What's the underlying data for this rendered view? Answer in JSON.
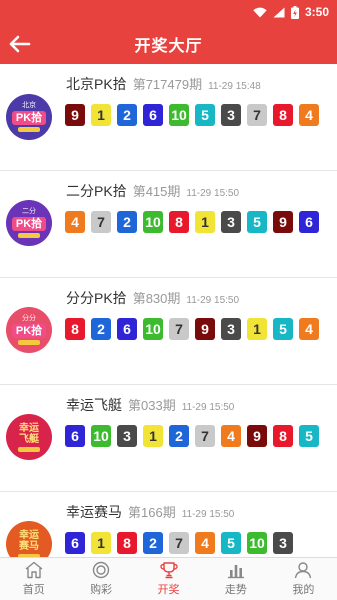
{
  "status": {
    "time": "3:50"
  },
  "header": {
    "title": "开奖大厅"
  },
  "colors": {
    "primary": "#e8423f",
    "1": "#f2e437",
    "2": "#1f67d8",
    "3": "#4a4a4a",
    "4": "#f07a1e",
    "5": "#18b7c6",
    "6": "#2f24d6",
    "7": "#c9c9c9",
    "8": "#e8192c",
    "9": "#7a0b0b",
    "10": "#3dbb2f"
  },
  "games": [
    {
      "name": "北京PK拾",
      "period": "第717479期",
      "time": "11-29 15:48",
      "logo_top": "北京",
      "logo_main": "PK拾",
      "logo_bg": "#4b3aa8",
      "numbers": [
        9,
        1,
        2,
        6,
        10,
        5,
        3,
        7,
        8,
        4
      ]
    },
    {
      "name": "二分PK拾",
      "period": "第415期",
      "time": "11-29 15:50",
      "logo_top": "二分",
      "logo_main": "PK拾",
      "logo_bg": "#6a33b8",
      "numbers": [
        4,
        7,
        2,
        10,
        8,
        1,
        3,
        5,
        9,
        6
      ]
    },
    {
      "name": "分分PK拾",
      "period": "第830期",
      "time": "11-29 15:50",
      "logo_top": "分分",
      "logo_main": "PK拾",
      "logo_bg": "#e84d6a",
      "numbers": [
        8,
        2,
        6,
        10,
        7,
        9,
        3,
        1,
        5,
        4
      ]
    },
    {
      "name": "幸运飞艇",
      "period": "第033期",
      "time": "11-29 15:50",
      "logo_top": "",
      "logo_main": "",
      "logo_alt": "幸运\n飞艇",
      "logo_bg": "#d8234a",
      "numbers": [
        6,
        10,
        3,
        1,
        2,
        7,
        4,
        9,
        8,
        5
      ]
    },
    {
      "name": "幸运赛马",
      "period": "第166期",
      "time": "11-29 15:50",
      "logo_top": "",
      "logo_main": "",
      "logo_alt": "幸运\n赛马",
      "logo_bg": "#e35a22",
      "numbers": [
        6,
        1,
        8,
        2,
        7,
        4,
        5,
        10,
        3
      ]
    }
  ],
  "tabs": [
    {
      "label": "首页",
      "icon": "home-icon"
    },
    {
      "label": "购彩",
      "icon": "coin-icon"
    },
    {
      "label": "开奖",
      "icon": "trophy-icon",
      "active": true
    },
    {
      "label": "走势",
      "icon": "chart-icon"
    },
    {
      "label": "我的",
      "icon": "user-icon"
    }
  ]
}
